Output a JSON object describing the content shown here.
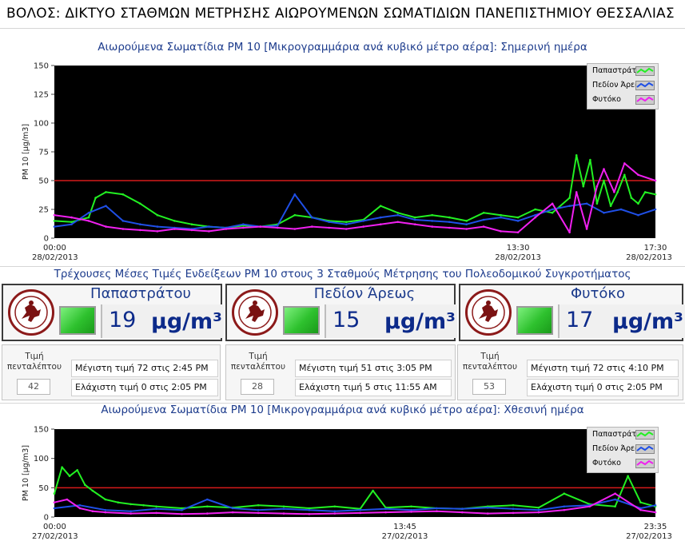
{
  "header": {
    "title": "ΒΟΛΟΣ: ΔΙΚΤΥΟ ΣΤΑΘΜΩΝ ΜΕΤΡΗΣΗΣ ΑΙΩΡΟΥΜΕΝΩΝ ΣΩΜΑΤΙΔΙΩΝ ΠΑΝΕΠΙΣΤΗΜΙΟΥ ΘΕΣΣΑΛΙΑΣ"
  },
  "today_chart": {
    "title": "Αιωρούμενα Σωματίδια PM 10 [Μικρογραμμάρια ανά κυβικό μέτρο αέρα]: Σημερινή ημέρα"
  },
  "yesterday_chart": {
    "title": "Αιωρούμενα Σωματίδια PM 10 [Μικρογραμμάρια ανά κυβικό μέτρο αέρα]: Χθεσινή ημέρα"
  },
  "section": {
    "title": "Τρέχουσες Μέσες Τιμές Ενδείξεων PM 10 στους 3 Σταθμούς Μέτρησης του Πολεοδομικού Συγκροτήματος"
  },
  "stations": [
    {
      "name": "Παπαστράτου",
      "value": "19",
      "unit": "μg/m³",
      "five_min_label": "Τιμή πενταλέπτου",
      "five_min_value": "42",
      "max_text": "Μέγιστη τιμή 72 στις 2:45 PM",
      "min_text": "Ελάχιστη τιμή 0 στις 2:05 PM",
      "led_color": "#2ec12e"
    },
    {
      "name": "Πεδίον Άρεως",
      "value": "15",
      "unit": "μg/m³",
      "five_min_label": "Τιμή πενταλέπτου",
      "five_min_value": "28",
      "max_text": "Μέγιστη τιμή 51 στις 3:05 PM",
      "min_text": "Ελάχιστη τιμή 5 στις 11:55 AM",
      "led_color": "#2ec12e"
    },
    {
      "name": "Φυτόκο",
      "value": "17",
      "unit": "μg/m³",
      "five_min_label": "Τιμή πενταλέπτου",
      "five_min_value": "53",
      "max_text": "Μέγιστη τιμή 72 στις 4:10 PM",
      "min_text": "Ελάχιστη τιμή 0 στις 2:05 PM",
      "led_color": "#2ec12e"
    }
  ],
  "chart_data": [
    {
      "type": "line",
      "title": "Αιωρούμενα Σωματίδια PM 10 [Μικρογραμμάρια ανά κυβικό μέτρο αέρα]: Σημερινή ημέρα",
      "ylabel": "PM 10 [μg/m3]",
      "ylim": [
        0,
        150
      ],
      "yticks": [
        "0",
        "25",
        "50",
        "75",
        "100",
        "125",
        "150"
      ],
      "xlim": [
        0,
        17.5
      ],
      "xticks": [
        {
          "x": 0,
          "time": "00:00",
          "date": "28/02/2013"
        },
        {
          "x": 13.5,
          "time": "13:30",
          "date": "28/02/2013"
        },
        {
          "x": 17.5,
          "time": "17:30",
          "date": "28/02/2013"
        }
      ],
      "limit_line": 50,
      "legend_position": "top-right",
      "background": "#000000",
      "series": [
        {
          "name": "Παπαστράτου",
          "color": "#22f022",
          "x": [
            0,
            0.5,
            1,
            1.2,
            1.5,
            2,
            2.5,
            3,
            3.5,
            4,
            4.5,
            5,
            5.5,
            6,
            6.5,
            7,
            7.5,
            8,
            8.5,
            9,
            9.5,
            10,
            10.5,
            11,
            11.5,
            12,
            12.5,
            13,
            13.5,
            14,
            14.5,
            15,
            15.2,
            15.4,
            15.6,
            15.8,
            16,
            16.2,
            16.4,
            16.6,
            16.8,
            17,
            17.2,
            17.5
          ],
          "values": [
            15,
            14,
            18,
            35,
            40,
            38,
            30,
            20,
            15,
            12,
            10,
            9,
            11,
            10,
            12,
            20,
            18,
            15,
            14,
            16,
            28,
            22,
            18,
            20,
            18,
            15,
            22,
            20,
            18,
            25,
            22,
            35,
            72,
            45,
            68,
            30,
            50,
            28,
            40,
            55,
            35,
            30,
            40,
            38
          ]
        },
        {
          "name": "Πεδίον Άρεως",
          "color": "#1f4fe6",
          "x": [
            0,
            0.5,
            1,
            1.5,
            2,
            2.5,
            3,
            3.5,
            4,
            4.5,
            5,
            5.5,
            6,
            6.5,
            7,
            7.5,
            8,
            8.5,
            9,
            9.5,
            10,
            10.5,
            11,
            11.5,
            12,
            12.5,
            13,
            13.5,
            14,
            14.5,
            15,
            15.5,
            16,
            16.5,
            17,
            17.5
          ],
          "values": [
            10,
            12,
            22,
            28,
            15,
            12,
            10,
            9,
            8,
            10,
            9,
            12,
            10,
            11,
            38,
            18,
            14,
            12,
            15,
            18,
            20,
            16,
            15,
            14,
            12,
            16,
            18,
            15,
            20,
            25,
            28,
            30,
            22,
            25,
            20,
            25
          ]
        },
        {
          "name": "Φυτόκο",
          "color": "#f020f0",
          "x": [
            0,
            0.5,
            1,
            1.5,
            2,
            2.5,
            3,
            3.5,
            4,
            4.5,
            5,
            5.5,
            6,
            6.5,
            7,
            7.5,
            8,
            8.5,
            9,
            9.5,
            10,
            10.5,
            11,
            11.5,
            12,
            12.5,
            13,
            13.5,
            14,
            14.5,
            15,
            15.2,
            15.5,
            15.8,
            16,
            16.3,
            16.6,
            17,
            17.5
          ],
          "values": [
            20,
            18,
            15,
            10,
            8,
            7,
            6,
            8,
            7,
            6,
            8,
            9,
            10,
            9,
            8,
            10,
            9,
            8,
            10,
            12,
            14,
            12,
            10,
            9,
            8,
            10,
            6,
            5,
            18,
            30,
            5,
            40,
            8,
            45,
            60,
            40,
            65,
            55,
            50
          ]
        }
      ]
    },
    {
      "type": "line",
      "title": "Αιωρούμενα Σωματίδια PM 10 [Μικρογραμμάρια ανά κυβικό μέτρο αέρα]: Χθεσινή ημέρα",
      "ylabel": "PM 10 [μg/m3]",
      "ylim": [
        0,
        150
      ],
      "yticks": [
        "0",
        "50",
        "100",
        "150"
      ],
      "xlim": [
        0,
        23.58
      ],
      "xticks": [
        {
          "x": 0,
          "time": "00:00",
          "date": "27/02/2013"
        },
        {
          "x": 13.75,
          "time": "13:45",
          "date": "27/02/2013"
        },
        {
          "x": 23.58,
          "time": "23:35",
          "date": "27/02/2013"
        }
      ],
      "limit_line": 50,
      "legend_position": "top-right",
      "background": "#000000",
      "series": [
        {
          "name": "Παπαστράτου",
          "color": "#22f022",
          "x": [
            0,
            0.3,
            0.6,
            0.9,
            1.2,
            1.5,
            2,
            2.5,
            3,
            3.5,
            4,
            5,
            6,
            7,
            8,
            9,
            10,
            11,
            12,
            12.5,
            13,
            14,
            15,
            16,
            17,
            18,
            19,
            20,
            21,
            22,
            22.5,
            23,
            23.58
          ],
          "values": [
            40,
            85,
            70,
            80,
            55,
            45,
            30,
            25,
            22,
            20,
            18,
            15,
            18,
            16,
            20,
            18,
            15,
            18,
            14,
            45,
            16,
            18,
            15,
            14,
            18,
            20,
            16,
            40,
            22,
            18,
            70,
            25,
            18
          ]
        },
        {
          "name": "Πεδίον Άρεως",
          "color": "#1f4fe6",
          "x": [
            0,
            1,
            2,
            3,
            4,
            5,
            6,
            7,
            8,
            9,
            10,
            11,
            12,
            13,
            14,
            15,
            16,
            17,
            18,
            19,
            20,
            21,
            22,
            23,
            23.58
          ],
          "values": [
            15,
            20,
            12,
            10,
            14,
            12,
            30,
            15,
            12,
            14,
            12,
            10,
            12,
            14,
            12,
            15,
            14,
            16,
            14,
            12,
            18,
            20,
            30,
            15,
            20
          ]
        },
        {
          "name": "Φυτόκο",
          "color": "#f020f0",
          "x": [
            0,
            0.5,
            1,
            1.5,
            2,
            3,
            4,
            5,
            6,
            7,
            8,
            9,
            10,
            11,
            12,
            13,
            14,
            15,
            16,
            17,
            18,
            19,
            20,
            21,
            22,
            23,
            23.58
          ],
          "values": [
            25,
            30,
            15,
            10,
            8,
            6,
            7,
            5,
            6,
            8,
            7,
            6,
            5,
            6,
            7,
            8,
            9,
            10,
            8,
            6,
            7,
            8,
            12,
            18,
            40,
            12,
            8
          ]
        }
      ]
    }
  ]
}
